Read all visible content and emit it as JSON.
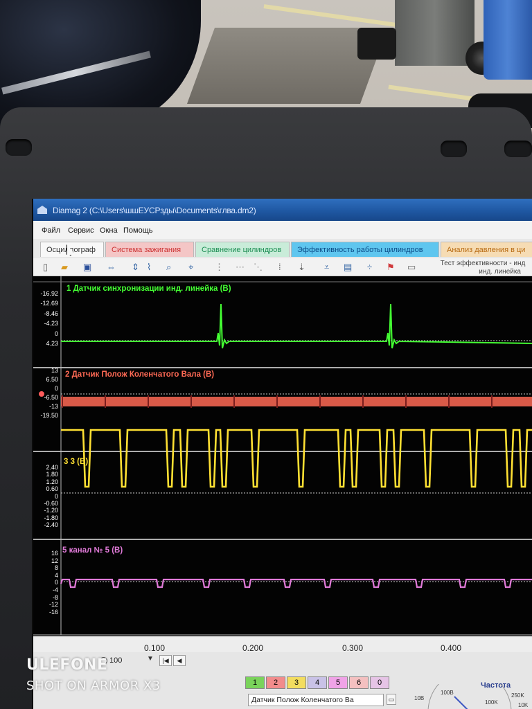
{
  "window": {
    "title": "Diamag 2 (C:\\Users\\шшЕУСРзды\\Documents\\глва.dm2)"
  },
  "menu": [
    "Файл",
    "Сервис",
    "Окна",
    "Помощь"
  ],
  "tabs": [
    "Осциллограф",
    "Система зажигания",
    "Сравнение цилиндров",
    "Эффективность работы цилиндров",
    "Анализ давления в ци"
  ],
  "toolbar": {
    "test_label_line1": "Тест эффективности - инд",
    "test_label_line2": "инд. линейка"
  },
  "channels": [
    {
      "title": "1 Датчик синхронизации инд. линейка (В)",
      "color": "#44ff33",
      "ticks": [
        "-16.92",
        "-12.69",
        "-8.46",
        "-4.23",
        "0",
        "4.23"
      ]
    },
    {
      "title": "2 Датчик Полож Коленчатого Вала (В)",
      "color": "#ff6a55",
      "ticks": [
        "13",
        "6.50",
        "0",
        "-6.50",
        "-13",
        "-19.50"
      ]
    },
    {
      "title": "3 3 (В)",
      "color": "#ffe033",
      "ticks": [
        "2.40",
        "1.80",
        "1.20",
        "0.60",
        "0",
        "-0.60",
        "-1.20",
        "-1.80",
        "-2.40"
      ]
    },
    {
      "title": "5 канал № 5 (В)",
      "color": "#e07ad8",
      "ticks": [
        "16",
        "12",
        "8",
        "4",
        "0",
        "-4",
        "-8",
        "-12",
        "-16"
      ]
    }
  ],
  "x_axis": [
    "0.100",
    "0.200",
    "0.300",
    "0.400"
  ],
  "bottom": {
    "zoom": "100",
    "channel_buttons": [
      "1",
      "2",
      "3",
      "4",
      "5",
      "6",
      "0"
    ],
    "channel_colors": [
      "#7ad35b",
      "#f28c8c",
      "#f3dd5f",
      "#c9c2e7",
      "#f0a3e7",
      "#f4c0c0",
      "#e6c4e6"
    ],
    "selected_channel": "Датчик Полож Коленчатого Ва",
    "freq_label": "Частота",
    "dial": [
      "10В",
      "100В",
      "250K",
      "100K",
      "10K"
    ]
  },
  "watermark": {
    "brand": "ULEFONE",
    "line2": "SHOT ON ARMOR X3"
  }
}
